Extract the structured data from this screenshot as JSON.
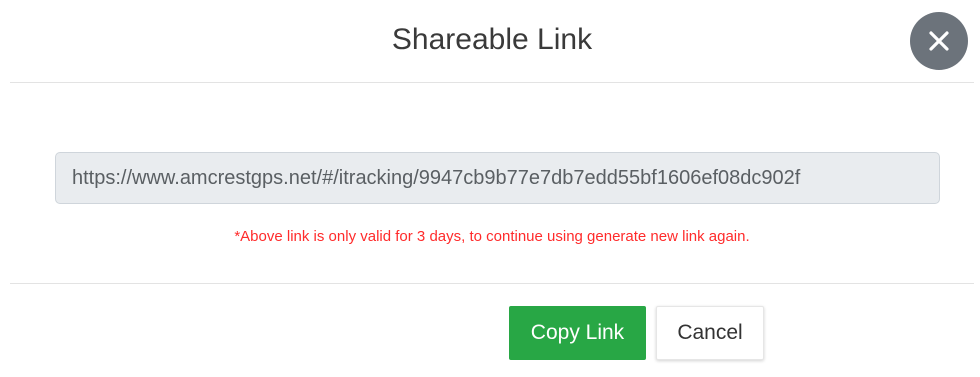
{
  "dialog": {
    "title": "Shareable Link",
    "close_icon": "close-icon"
  },
  "link": {
    "value": "https://www.amcrestgps.net/#/itracking/9947cb9b77e7db7edd55bf1606ef08dc902f",
    "note": "*Above link is only valid for 3 days, to continue using generate new link again."
  },
  "footer": {
    "copy_label": "Copy Link",
    "cancel_label": "Cancel"
  },
  "colors": {
    "primary_green": "#28a745",
    "note_red": "#ff2b2b",
    "close_bg": "#6c737b"
  }
}
